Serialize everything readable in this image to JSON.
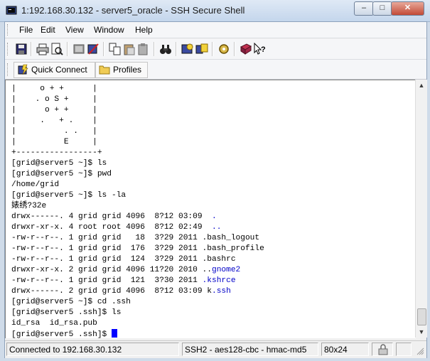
{
  "window": {
    "title": "1:192.168.30.132 - server5_oracle - SSH Secure Shell",
    "min_glyph": "–",
    "max_glyph": "□",
    "close_glyph": "✕"
  },
  "menu": [
    "File",
    "Edit",
    "View",
    "Window",
    "Help"
  ],
  "toolbar": {
    "icons": [
      "save-icon",
      "print-icon",
      "print-preview-icon",
      "disconnect-icon",
      "connect-icon",
      "copy-icon",
      "paste-icon",
      "paste-alt-icon",
      "find-icon",
      "new-terminal-icon",
      "new-file-transfer-icon",
      "settings-icon",
      "help-topics-icon",
      "context-help-icon"
    ]
  },
  "quickbar": {
    "quick_connect": "Quick Connect",
    "profiles": "Profiles"
  },
  "terminal": {
    "lines": [
      "|     o + +      |",
      "|    . o S +     |",
      "|      o + +     |",
      "|     .   + .    |",
      "|          . .   |",
      "|          E     |",
      "+-----------------+",
      "[grid@server5 ~]$ ls",
      "[grid@server5 ~]$ pwd",
      "/home/grid",
      "[grid@server5 ~]$ ls -la",
      "婊绣?32e",
      "drwx------. 4 grid grid 4096  8?12 03:09  .",
      "drwxr-xr-x. 4 root root 4096  8?12 02:49  ..",
      "-rw-r--r--. 1 grid grid   18  3?29 2011 .bash_logout",
      "-rw-r--r--. 1 grid grid  176  3?29 2011 .bash_profile",
      "-rw-r--r--. 1 grid grid  124  3?29 2011 .bashrc",
      "drwxr-xr-x. 2 grid grid 4096 11?20 2010 ..gnome2",
      "-rw-r--r--. 1 grid grid  121  3?30 2011 .kshrce",
      "drwx------. 2 grid grid 4096  8?12 03:09 k.ssh",
      "[grid@server5 ~]$ cd .ssh",
      "[grid@server5 .ssh]$ ls",
      "id_rsa  id_rsa.pub",
      "[grid@server5 .ssh]$ "
    ],
    "dir_colors": {
      "regular": "#000000",
      "directory": "#0000c8"
    }
  },
  "status": {
    "connection": "Connected to 192.168.30.132",
    "cipher": "SSH2 - aes128-cbc - hmac-md5",
    "size": "80x24"
  }
}
